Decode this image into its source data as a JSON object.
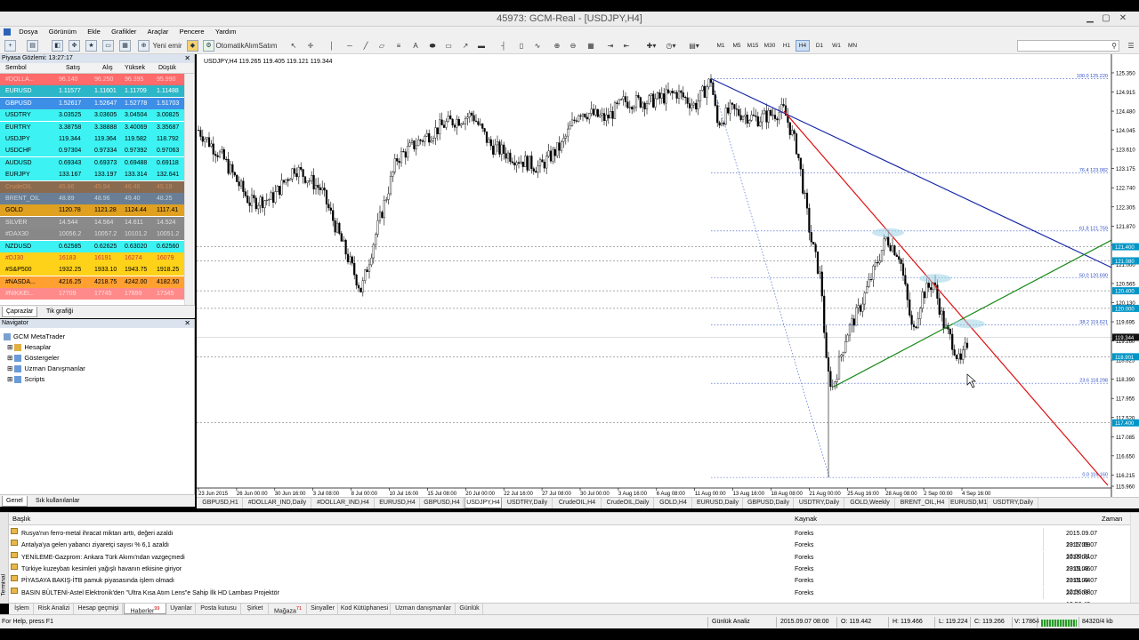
{
  "window": {
    "title": "45973: GCM-Real - [USDJPY,H4]"
  },
  "menu": [
    "Dosya",
    "Görünüm",
    "Ekle",
    "Grafikler",
    "Araçlar",
    "Pencere",
    "Yardım"
  ],
  "toolbar": {
    "new_order": "Yeni emir",
    "autotrade": "OtomatikAlımSatım",
    "timeframes": [
      "M1",
      "M5",
      "M15",
      "M30",
      "H1",
      "H4",
      "D1",
      "W1",
      "MN"
    ],
    "active_timeframe": "H4",
    "text_tool": "A"
  },
  "market_watch": {
    "title": "Piyasa Gözlemi: 13:27:17",
    "columns": [
      "Sembol",
      "Satış",
      "Alış",
      "Yüksek",
      "Düşük"
    ],
    "rows": [
      {
        "symbol": "#DOLLA...",
        "bid": "96.140",
        "ask": "96.250",
        "high": "96.395",
        "low": "95.990",
        "bg": "#ff6a6a",
        "fg": "#ffd0d0"
      },
      {
        "symbol": "EURUSD",
        "bid": "1.11577",
        "ask": "1.11601",
        "high": "1.11709",
        "low": "1.11488",
        "bg": "#2bb7c7",
        "fg": "#ffffff"
      },
      {
        "symbol": "GBPUSD",
        "bid": "1.52617",
        "ask": "1.52647",
        "high": "1.52778",
        "low": "1.51703",
        "bg": "#3d8ee6",
        "fg": "#ffffff"
      },
      {
        "symbol": "USDTRY",
        "bid": "3.03525",
        "ask": "3.03605",
        "high": "3.04504",
        "low": "3.00825",
        "bg": "#3df2f2",
        "fg": "#000000"
      },
      {
        "symbol": "EURTRY",
        "bid": "3.38758",
        "ask": "3.38888",
        "high": "3.40069",
        "low": "3.35687",
        "bg": "#3df2f2",
        "fg": "#000000"
      },
      {
        "symbol": "USDJPY",
        "bid": "119.344",
        "ask": "119.364",
        "high": "119.582",
        "low": "118.792",
        "bg": "#3df2f2",
        "fg": "#000000"
      },
      {
        "symbol": "USDCHF",
        "bid": "0.97304",
        "ask": "0.97334",
        "high": "0.97392",
        "low": "0.97063",
        "bg": "#3df2f2",
        "fg": "#000000"
      },
      {
        "symbol": "AUDUSD",
        "bid": "0.69343",
        "ask": "0.69373",
        "high": "0.69488",
        "low": "0.69118",
        "bg": "#3df2f2",
        "fg": "#000000"
      },
      {
        "symbol": "EURJPY",
        "bid": "133.167",
        "ask": "133.197",
        "high": "133.314",
        "low": "132.641",
        "bg": "#3df2f2",
        "fg": "#000000"
      },
      {
        "symbol": "CrudeOIL",
        "bid": "45.86",
        "ask": "45.94",
        "high": "46.46",
        "low": "45.19",
        "bg": "#8b6b50",
        "fg": "#c98a5a"
      },
      {
        "symbol": "BRENT_OIL",
        "bid": "48.89",
        "ask": "48.96",
        "high": "49.40",
        "low": "48.25",
        "bg": "#6a7f95",
        "fg": "#c7d3df"
      },
      {
        "symbol": "GOLD",
        "bid": "1120.78",
        "ask": "1121.28",
        "high": "1124.44",
        "low": "1117.41",
        "bg": "#e0a020",
        "fg": "#000000"
      },
      {
        "symbol": "SILVER",
        "bid": "14.544",
        "ask": "14.564",
        "high": "14.611",
        "low": "14.524",
        "bg": "#8a8a8a",
        "fg": "#e0e0e0"
      },
      {
        "symbol": "#DAX30",
        "bid": "10056.2",
        "ask": "10057.2",
        "high": "10101.2",
        "low": "10051.2",
        "bg": "#888888",
        "fg": "#dddddd"
      },
      {
        "symbol": "NZDUSD",
        "bid": "0.62585",
        "ask": "0.62625",
        "high": "0.63020",
        "low": "0.62560",
        "bg": "#3df2f2",
        "fg": "#000000"
      },
      {
        "symbol": "#DJ30",
        "bid": "16183",
        "ask": "16191",
        "high": "16274",
        "low": "16079",
        "bg": "#ffd21a",
        "fg": "#c83030"
      },
      {
        "symbol": "#S&P500",
        "bid": "1932.25",
        "ask": "1933.10",
        "high": "1943.75",
        "low": "1918.25",
        "bg": "#ffd21a",
        "fg": "#000000"
      },
      {
        "symbol": "#NASDA...",
        "bid": "4216.25",
        "ask": "4218.75",
        "high": "4242.00",
        "low": "4182.50",
        "bg": "#ffa030",
        "fg": "#000000"
      },
      {
        "symbol": "#NIKKEI...",
        "bid": "17709",
        "ask": "17745",
        "high": "17899",
        "low": "17345",
        "bg": "#ff8a8a",
        "fg": "#ffdede"
      }
    ],
    "tabs": [
      "Çaprazlar",
      "Tik grafiği"
    ]
  },
  "navigator": {
    "title": "Navigator",
    "root": "GCM MetaTrader",
    "items": [
      "Hesaplar",
      "Göstergeler",
      "Uzman Danışmanlar",
      "Scripts"
    ],
    "tabs": [
      "Genel",
      "Sık kullanılanlar"
    ]
  },
  "chart": {
    "header": "USDJPY,H4  119.265 119.405 119.121 119.344",
    "price_labels": [
      "125.350",
      "124.915",
      "124.480",
      "124.045",
      "123.610",
      "123.175",
      "122.740",
      "122.305",
      "121.870",
      "121.435",
      "121.000",
      "120.565",
      "120.130",
      "119.695",
      "119.260",
      "118.825",
      "118.390",
      "117.955",
      "117.520",
      "117.085",
      "116.650",
      "116.215",
      "115.960"
    ],
    "marked_prices": [
      {
        "label": "121.400",
        "bg": "#0096c8"
      },
      {
        "label": "121.080",
        "bg": "#0096c8"
      },
      {
        "label": "120.400",
        "bg": "#0096c8"
      },
      {
        "label": "120.000",
        "bg": "#0096c8"
      },
      {
        "label": "119.344",
        "bg": "#111111"
      },
      {
        "label": "118.901",
        "bg": "#0096c8"
      },
      {
        "label": "117.400",
        "bg": "#0096c8"
      }
    ],
    "fibo_labels": [
      "100.0 125.220",
      "76.4 123.082",
      "61.8 121.759",
      "50.0 120.690",
      "38.2 119.621",
      "23.6 118.298",
      "0.0 116.160"
    ],
    "date_labels": [
      "23 Jun 2015",
      "26 Jun 00:00",
      "30 Jun 16:00",
      "3 Jul 08:00",
      "8 Jul 00:00",
      "10 Jul 16:00",
      "15 Jul 08:00",
      "20 Jul 00:00",
      "22 Jul 16:00",
      "27 Jul 08:00",
      "30 Jul 00:00",
      "3 Aug 16:00",
      "6 Aug 08:00",
      "11 Aug 00:00",
      "13 Aug 16:00",
      "18 Aug 08:00",
      "21 Aug 00:00",
      "25 Aug 16:00",
      "28 Aug 08:00",
      "2 Sep 00:00",
      "4 Sep 16:00"
    ]
  },
  "chart_tabs": [
    "GBPUSD,H1",
    "#DOLLAR_IND,Daily",
    "#DOLLAR_IND,H4",
    "EURUSD,H4",
    "GBPUSD,H4",
    "USDJPY,H4",
    "USDTRY,Daily",
    "CrudeOIL,H4",
    "CrudeOIL,Daily",
    "GOLD,H4",
    "EURUSD,Daily",
    "GBPUSD,Daily",
    "USDTRY,Daily",
    "GOLD,Weekly",
    "BRENT_OIL,H4",
    "EURUSD,M1",
    "USDTRY,Daily"
  ],
  "active_chart_tab": "USDJPY,H4",
  "terminal": {
    "side_label": "Terminal",
    "columns": [
      "Başlık",
      "Kaynak",
      "Zaman"
    ],
    "news": [
      {
        "title": "Rusya'nın ferro-metal ihracat miktarı arttı, değeri azaldı",
        "source": "Foreks",
        "time": "2015.09.07 13:17:09"
      },
      {
        "title": "Antalya'ya gelen yabancı ziyaretçi sayısı % 6,1 azaldı",
        "source": "Foreks",
        "time": "2015.09.07 13:09:31"
      },
      {
        "title": "YENİLEME-Gazprom: Ankara Türk Akımı'ndan vazgeçmedi",
        "source": "Foreks",
        "time": "2015.09.07 13:01:46"
      },
      {
        "title": "Türkiye kuzeybatı kesimleri yağışlı havanın etkisine giriyor",
        "source": "Foreks",
        "time": "2015.09.07 13:01:44"
      },
      {
        "title": "PİYASAYA BAKIŞ-İTB pamuk piyasasında işlem olmadı",
        "source": "Foreks",
        "time": "2015.09.07 12:56:08"
      },
      {
        "title": "BASIN BÜLTENİ-Astel Elektronik'den \"Ultra Kısa Atım Lens\"e Sahip İlk HD Lambası Projektör",
        "source": "Foreks",
        "time": "2015.09.07 12:50:49"
      }
    ],
    "tabs": [
      "İşlem",
      "Risk Analizi",
      "Hesap geçmişi",
      "Haberler",
      "Uyarılar",
      "Posta kutusu",
      "Şirket",
      "Mağaza",
      "Sinyaller",
      "Kod Kütüphanesi",
      "Uzman danışmanlar",
      "Günlük"
    ],
    "active_tab": "Haberler",
    "tab_badges": {
      "Haberler": "99",
      "Mağaza": "71"
    }
  },
  "status": {
    "help": "For Help, press F1",
    "profile": "Günlük Analiz",
    "time": "2015.09.07 08:00",
    "open": "O: 119.442",
    "high": "H: 119.466",
    "low": "L: 119.224",
    "close": "C: 119.266",
    "volume": "V: 17864",
    "traffic": "84320/4 kb"
  },
  "colors": {
    "resistance_line": "#1a2aa8",
    "down_trend": "#e01010",
    "up_trend": "#1a8a1a",
    "fibo": "#3050c8"
  }
}
